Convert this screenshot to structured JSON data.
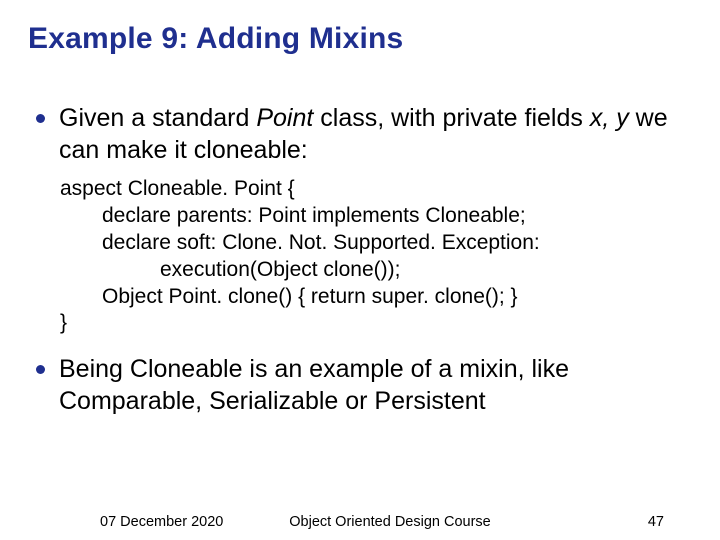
{
  "title": "Example 9: Adding Mixins",
  "bullets": [
    {
      "parts": [
        "Given a standard ",
        "Point",
        " class, with private fields ",
        "x, y",
        " we can make it cloneable:"
      ]
    },
    {
      "text": "Being Cloneable is an example of a mixin, like Comparable, Serializable or Persistent"
    }
  ],
  "code": [
    "aspect Cloneable. Point {",
    "declare parents: Point implements Cloneable;",
    "declare soft: Clone. Not. Supported. Exception:",
    "execution(Object clone());",
    "Object Point. clone() { return super. clone(); }",
    "}"
  ],
  "footer": {
    "date": "07 December 2020",
    "course": "Object Oriented Design Course",
    "page": "47"
  }
}
